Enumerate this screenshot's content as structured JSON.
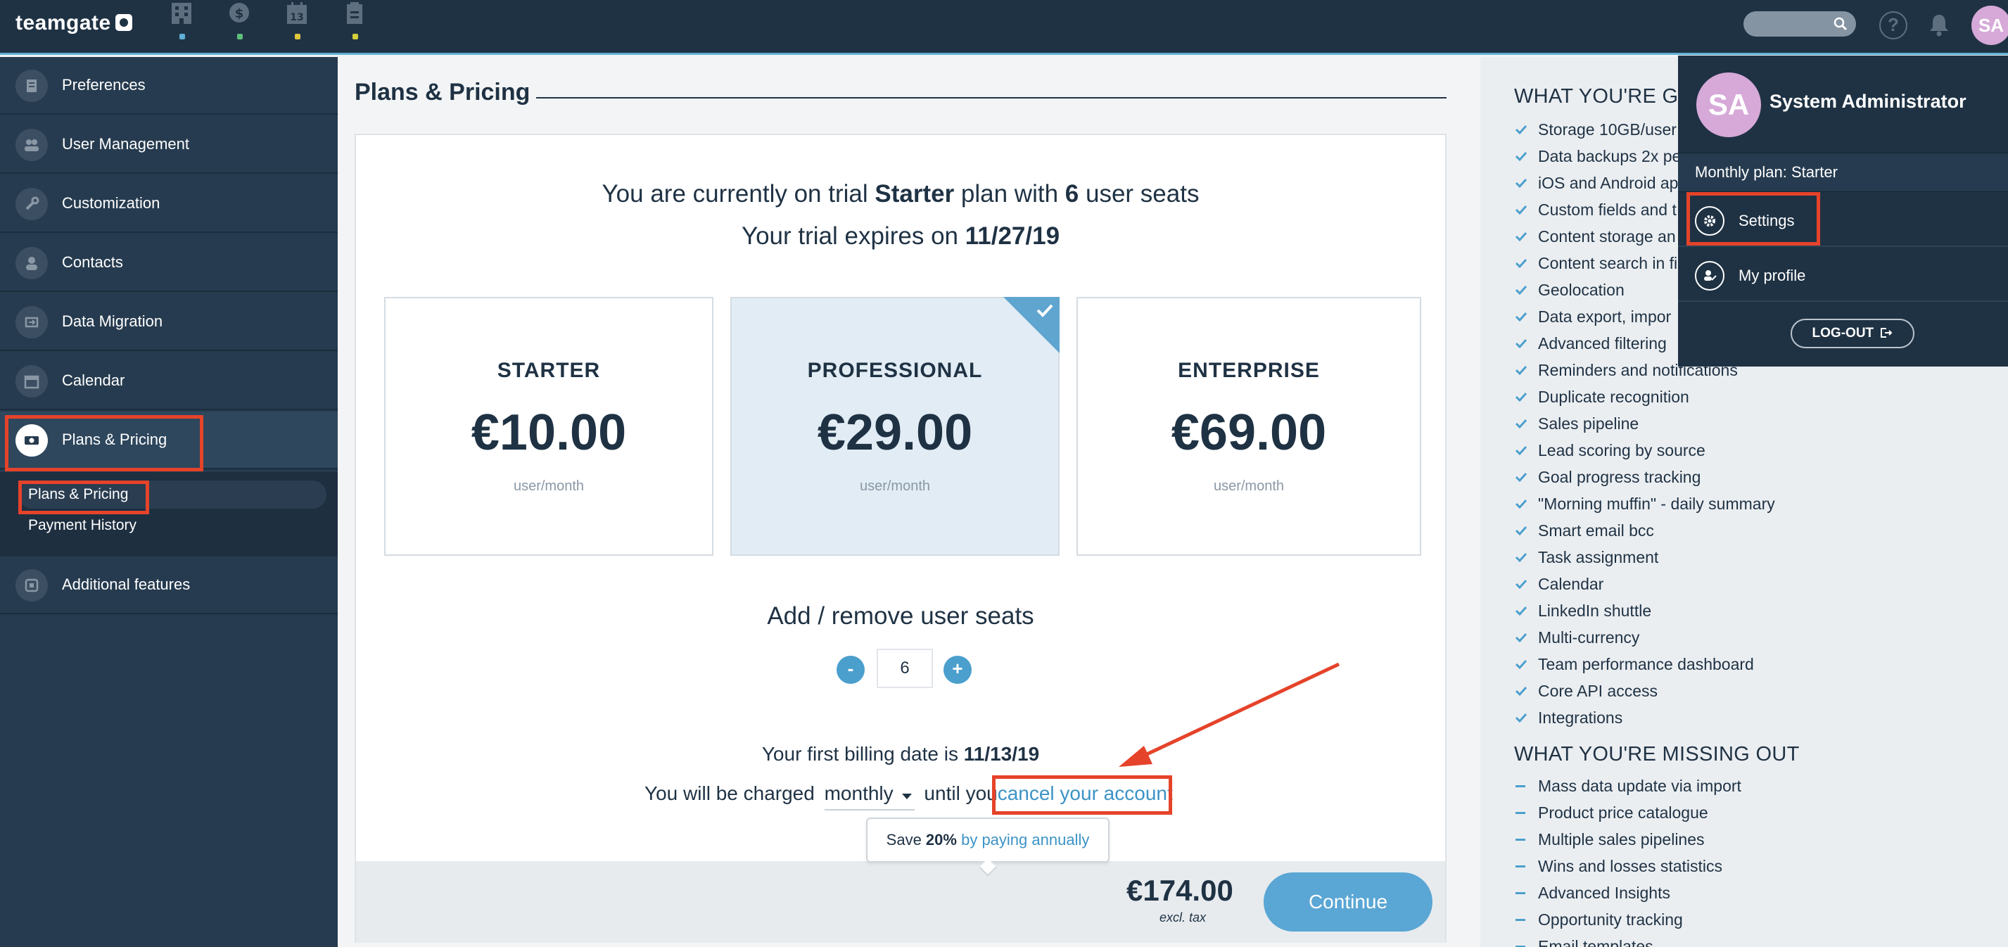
{
  "app": {
    "logo_text": "teamgate"
  },
  "topbar": {
    "nav_icons": [
      {
        "icon": "company-building-icon",
        "dot_color": "#5fb0d6"
      },
      {
        "icon": "deals-coin-icon",
        "dot_color": "#5fc07a"
      },
      {
        "icon": "calendar-icon",
        "dot_color": "#e0c63c",
        "glyph_text": "13"
      },
      {
        "icon": "documents-icon",
        "dot_color": "#d4cf3a"
      }
    ],
    "avatar_initials": "SA"
  },
  "sidebar": {
    "items": [
      {
        "label": "Preferences",
        "icon": "preferences-icon"
      },
      {
        "label": "User Management",
        "icon": "users-icon"
      },
      {
        "label": "Customization",
        "icon": "wrench-icon"
      },
      {
        "label": "Contacts",
        "icon": "contact-icon"
      },
      {
        "label": "Data Migration",
        "icon": "migration-icon"
      },
      {
        "label": "Calendar",
        "icon": "calendar-icon"
      },
      {
        "label": "Plans & Pricing",
        "icon": "money-icon",
        "active": true
      },
      {
        "label": "Additional features",
        "icon": "extension-icon"
      }
    ],
    "submenu": [
      {
        "label": "Plans & Pricing",
        "active": true
      },
      {
        "label": "Payment History"
      }
    ]
  },
  "main": {
    "title": "Plans & Pricing",
    "trial": {
      "prefix": "You are currently on trial ",
      "plan": "Starter",
      "middle": " plan with ",
      "seats": "6",
      "suffix": " user seats",
      "expiry_prefix": "Your trial expires on ",
      "expiry_date": "11/27/19"
    },
    "plans": [
      {
        "name": "STARTER",
        "price": "€10.00",
        "unit": "user/month",
        "selected": false
      },
      {
        "name": "PROFESSIONAL",
        "price": "€29.00",
        "unit": "user/month",
        "selected": true
      },
      {
        "name": "ENTERPRISE",
        "price": "€69.00",
        "unit": "user/month",
        "selected": false
      }
    ],
    "seats": {
      "heading": "Add / remove user seats",
      "minus": "-",
      "plus": "+",
      "value": "6"
    },
    "billing": {
      "first_prefix": "Your first billing date is ",
      "first_date": "11/13/19",
      "charge_prefix": "You will be charged",
      "frequency": "monthly",
      "until": "until you",
      "cancel_link": "cancel your account"
    },
    "tooltip": {
      "prefix": "Save ",
      "percent": "20%",
      "link": "by paying annually"
    },
    "footer": {
      "total": "€174.00",
      "note": "excl. tax",
      "continue": "Continue"
    }
  },
  "features": {
    "getting_heading": "WHAT YOU'RE GE",
    "getting": [
      "Storage 10GB/user",
      "Data backups 2x pe",
      "iOS and Android ap",
      "Custom fields and t",
      "Content storage an",
      "Content search in fi",
      "Geolocation",
      "Data export, impor",
      "Advanced filtering",
      "Reminders and notifications",
      "Duplicate recognition",
      "Sales pipeline",
      "Lead scoring by source",
      "Goal progress tracking",
      "\"Morning muffin\" - daily summary",
      "Smart email bcc",
      "Task assignment",
      "Calendar",
      "LinkedIn shuttle",
      "Multi-currency",
      "Team performance dashboard",
      "Core API access",
      "Integrations"
    ],
    "missing_heading": "WHAT YOU'RE MISSING OUT",
    "missing": [
      "Mass data update via import",
      "Product price catalogue",
      "Multiple sales pipelines",
      "Wins and losses statistics",
      "Advanced Insights",
      "Opportunity tracking",
      "Email templates"
    ],
    "check_color": "#4b9fcd"
  },
  "profile_menu": {
    "initials": "SA",
    "name": "System Administrator",
    "plan": "Monthly plan: Starter",
    "settings": "Settings",
    "profile": "My profile",
    "logout": "LOG-OUT"
  },
  "colors": {
    "navy": "#1f3244",
    "sidebar": "#263b4f",
    "accent": "#4b9fcd",
    "annotation_red": "#e5432a"
  }
}
